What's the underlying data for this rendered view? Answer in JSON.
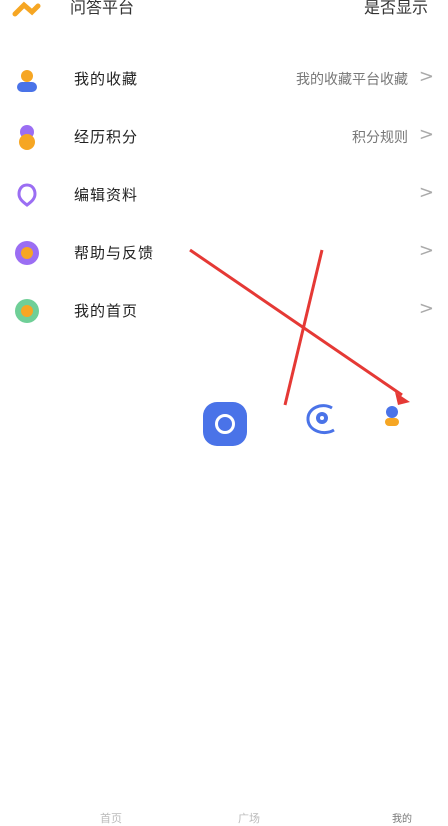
{
  "top": {
    "left_label": "问答平台",
    "right_label": "是否显示"
  },
  "rows": [
    {
      "label": "我的收藏",
      "right": "我的收藏平台收藏"
    },
    {
      "label": "经历积分",
      "right": "积分规则"
    },
    {
      "label": "编辑资料",
      "right": ""
    },
    {
      "label": "帮助与反馈",
      "right": ""
    },
    {
      "label": "我的首页",
      "right": ""
    }
  ],
  "chevron": ">",
  "bottom": {
    "left_text": "首页",
    "mid_text": "广场",
    "right_text": "我的"
  },
  "colors": {
    "orange": "#f6a623",
    "purple": "#9b6ef3",
    "blue": "#4a73e8",
    "red": "#e53935"
  }
}
